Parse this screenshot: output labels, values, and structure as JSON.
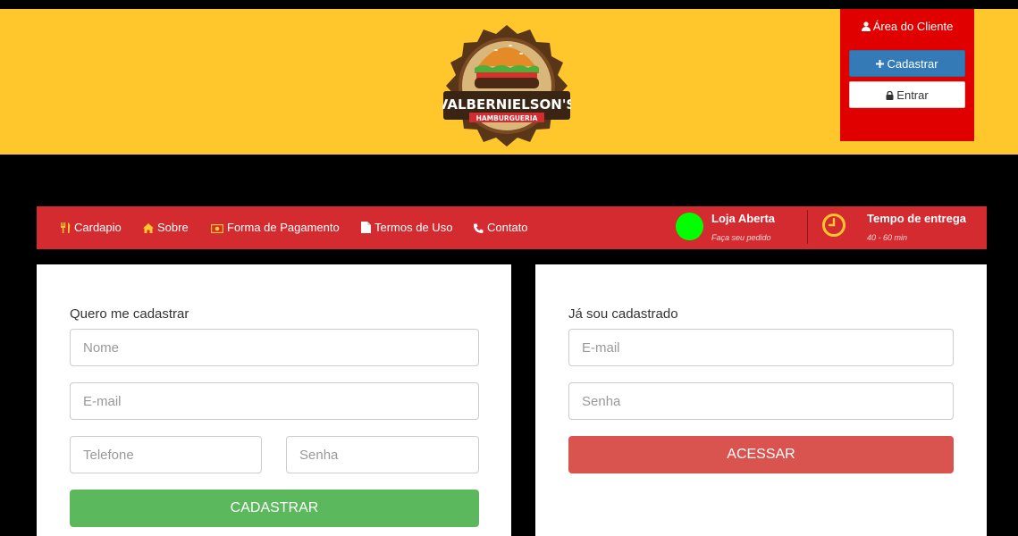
{
  "brand": {
    "name": "VALBERNIELSON'S",
    "tagline": "HAMBURGUERIA",
    "colors": {
      "header": "#ffc72c",
      "accent": "#d42b30",
      "client_box": "#e00000"
    }
  },
  "client_area": {
    "title": "Área do Cliente",
    "register_label": "Cadastrar",
    "login_label": "Entrar",
    "icons": [
      "user-icon",
      "plus-icon",
      "lock-icon"
    ]
  },
  "nav": {
    "items": [
      {
        "label": "Cardapio",
        "icon": "utensils-icon"
      },
      {
        "label": "Sobre",
        "icon": "home-icon"
      },
      {
        "label": "Forma de Pagamento",
        "icon": "money-icon"
      },
      {
        "label": "Termos de Uso",
        "icon": "document-icon"
      },
      {
        "label": "Contato",
        "icon": "phone-icon"
      }
    ],
    "store_status": {
      "title": "Loja Aberta",
      "subtitle": "Faça seu pedido",
      "color": "#00ff00"
    },
    "delivery": {
      "title": "Tempo de entrega",
      "subtitle": "40 - 60 min",
      "icon": "clock-icon"
    }
  },
  "register": {
    "title": "Quero me cadastrar",
    "name_placeholder": "Nome",
    "email_placeholder": "E-mail",
    "phone_placeholder": "Telefone",
    "password_placeholder": "Senha",
    "submit_label": "CADASTRAR"
  },
  "login": {
    "title": "Já sou cadastrado",
    "email_placeholder": "E-mail",
    "password_placeholder": "Senha",
    "submit_label": "ACESSAR"
  }
}
